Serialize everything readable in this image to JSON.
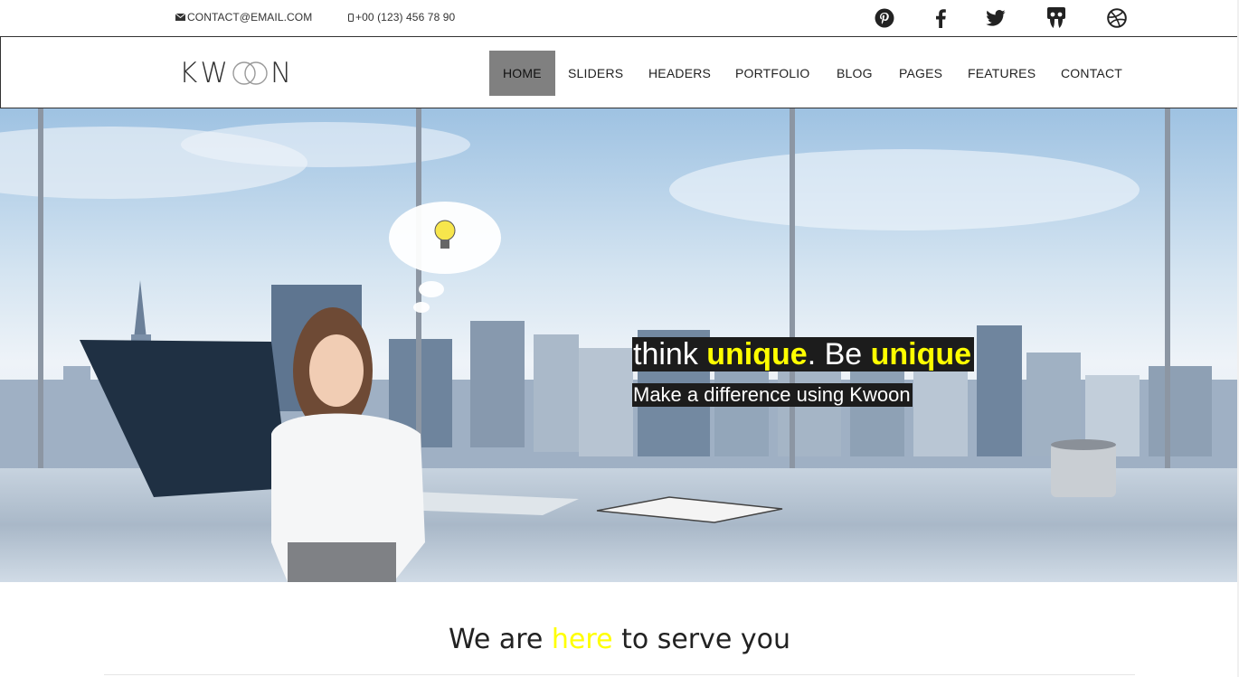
{
  "topbar": {
    "email": "CONTACT@EMAIL.COM",
    "phone": "+00 (123) 456 78 90",
    "email_icon": "envelope-icon",
    "phone_icon": "mobile-phone-icon",
    "social": [
      "pinterest-icon",
      "facebook-icon",
      "twitter-icon",
      "slideshare-icon",
      "dribbble-icon"
    ]
  },
  "nav": {
    "logo": {
      "k": "K",
      "w": "W",
      "n": "N"
    },
    "items": [
      {
        "label": "HOME",
        "active": true
      },
      {
        "label": "SLIDERS"
      },
      {
        "label": "HEADERS"
      },
      {
        "label": "PORTFOLIO"
      },
      {
        "label": "BLOG"
      },
      {
        "label": "PAGES"
      },
      {
        "label": "FEATURES"
      },
      {
        "label": "CONTACT"
      }
    ]
  },
  "hero": {
    "line1": {
      "part1": "think ",
      "part2": "unique",
      "part3": ". Be ",
      "part4": "unique"
    },
    "line2": "Make a difference using Kwoon"
  },
  "section": {
    "title": {
      "part1": "We are ",
      "part2": "here",
      "part3": " to serve you"
    }
  },
  "colors": {
    "accent": "#ffff00",
    "nav_active_bg": "#808080",
    "caption_bg": "#1c1c1c"
  }
}
